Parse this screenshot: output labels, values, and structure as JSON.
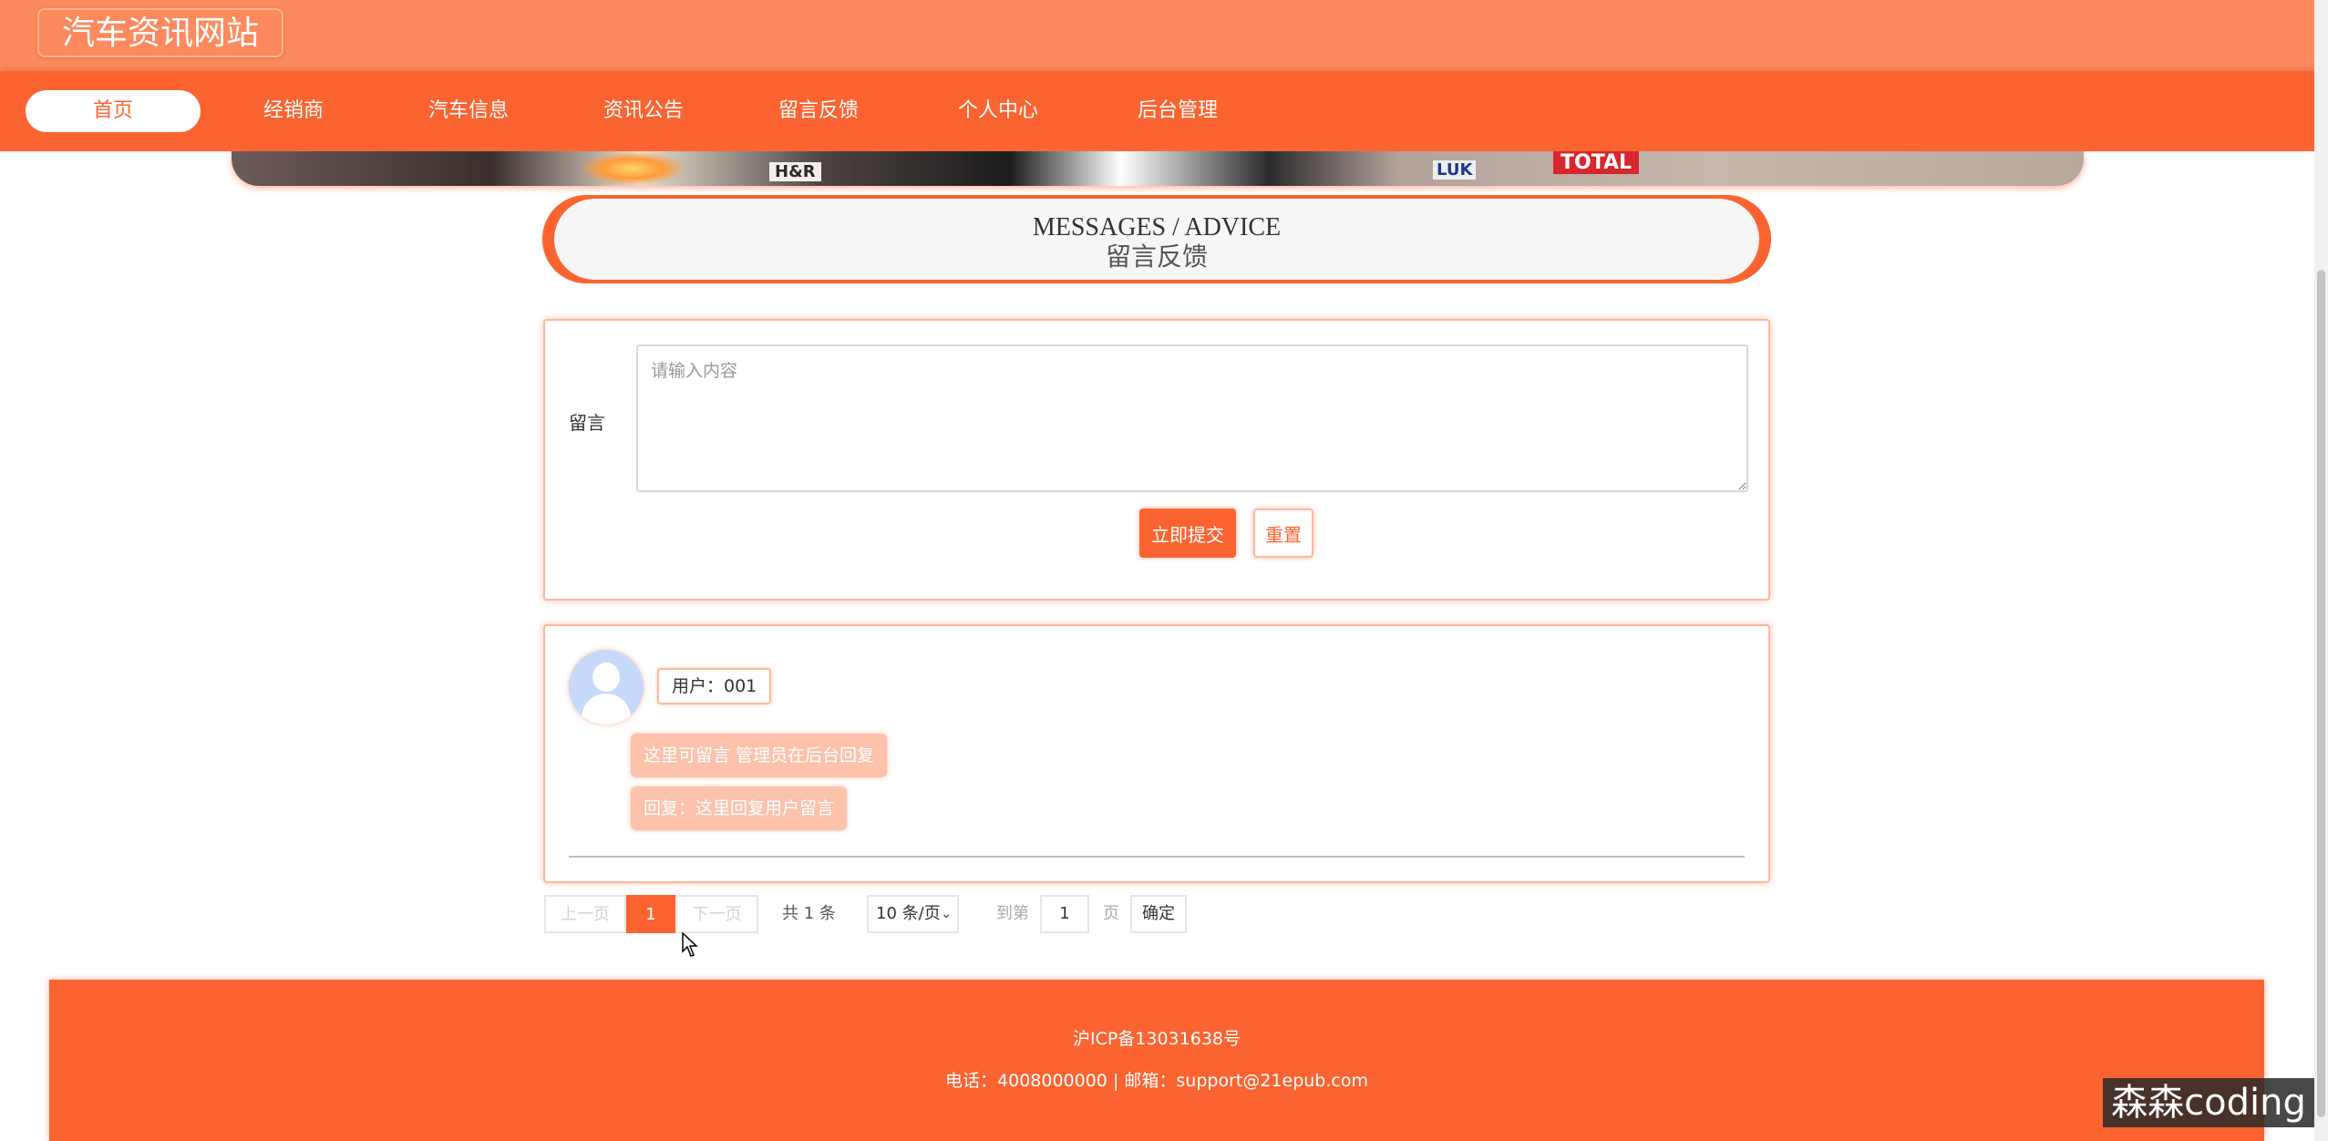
{
  "site": {
    "title": "汽车资讯网站"
  },
  "nav": {
    "items": [
      {
        "label": "首页",
        "active": true
      },
      {
        "label": "经销商"
      },
      {
        "label": "汽车信息"
      },
      {
        "label": "资讯公告"
      },
      {
        "label": "留言反馈"
      },
      {
        "label": "个人中心"
      },
      {
        "label": "后台管理"
      }
    ]
  },
  "banner": {
    "sponsors": [
      "H&R",
      "LUK",
      "TOTAL"
    ]
  },
  "section": {
    "title_en": "MESSAGES / ADVICE",
    "title_cn": "留言反馈"
  },
  "form": {
    "label": "留言",
    "placeholder": "请输入内容",
    "submit_label": "立即提交",
    "reset_label": "重置"
  },
  "messages": [
    {
      "user": "用户：001",
      "content": "这里可留言 管理员在后台回复",
      "reply": "回复：这里回复用户留言"
    }
  ],
  "pagination": {
    "prev_label": "上一页",
    "current_page": "1",
    "next_label": "下一页",
    "total_text": "共 1 条",
    "page_size": "10 条/页",
    "goto_label": "到第",
    "goto_value": "1",
    "page_suffix": "页",
    "confirm_label": "确定"
  },
  "footer": {
    "icp": "沪ICP备13031638号",
    "contact": "电话：4008000000 | 邮箱：support@21epub.com"
  },
  "watermark": "森森coding",
  "colors": {
    "primary": "#fb6431",
    "topbar": "#fd8a5e",
    "light": "#fcc2ab"
  }
}
